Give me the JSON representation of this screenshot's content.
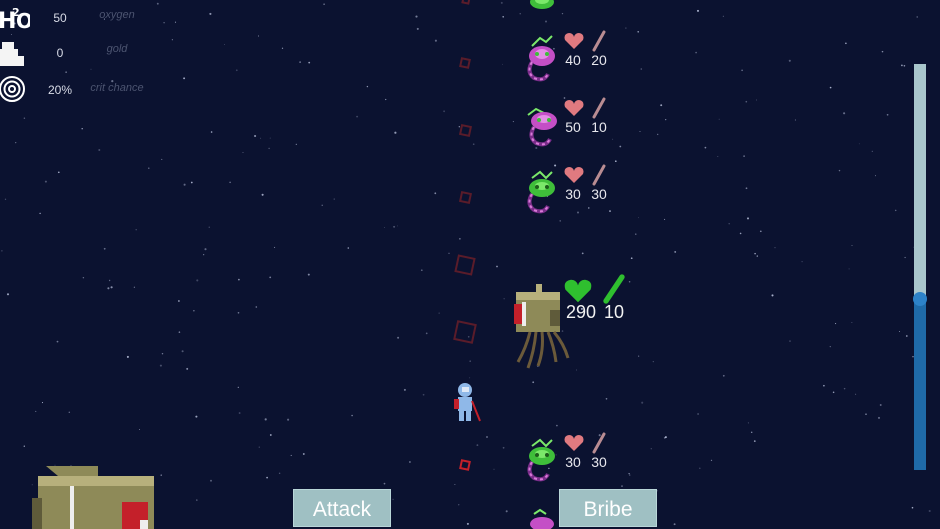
{
  "stats": [
    {
      "icon": "h2o-icon",
      "value": "50",
      "label": "oxygen"
    },
    {
      "icon": "gold-icon",
      "value": "0",
      "label": "gold"
    },
    {
      "icon": "target-icon",
      "value": "20%",
      "label": "crit chance"
    }
  ],
  "enemies": [
    {
      "hp": "40",
      "attack": "20",
      "color": "#c44fc6"
    },
    {
      "hp": "50",
      "attack": "10",
      "color": "#c44fc6"
    },
    {
      "hp": "30",
      "attack": "30",
      "color": "#3fbe3a"
    },
    {
      "hp": "30",
      "attack": "30",
      "color": "#3fbe3a"
    }
  ],
  "boss": {
    "hp": "290",
    "attack": "10"
  },
  "buttons": {
    "attack": "Attack",
    "bribe": "Bribe"
  },
  "progress": {
    "fraction": 0.42
  },
  "colors": {
    "background": "#0b1230",
    "button": "#9fc0c3",
    "heart": "#e07a80",
    "boss_heart": "#2fbf2f",
    "path_marker": "#c4202a"
  }
}
